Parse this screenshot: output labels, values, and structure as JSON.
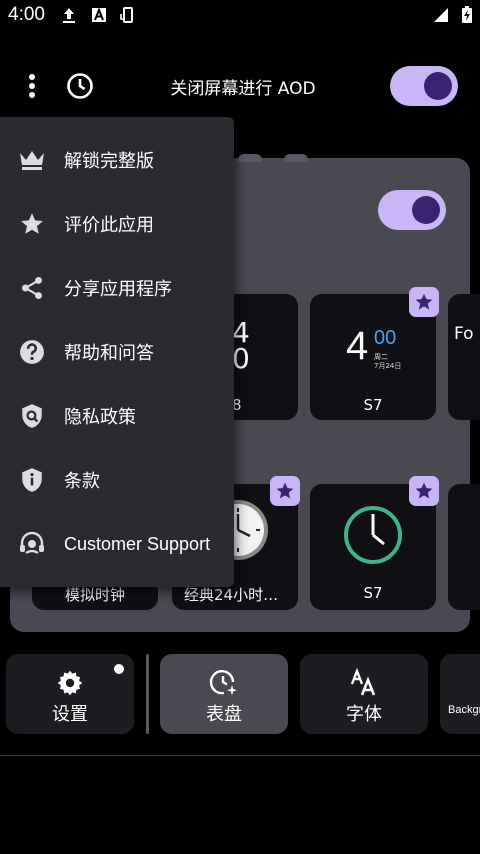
{
  "status_bar": {
    "time": "4:00"
  },
  "top_bar": {
    "title": "关闭屏幕进行 AOD"
  },
  "menu": {
    "items": [
      {
        "label": "解锁完整版",
        "icon": "crown-icon"
      },
      {
        "label": "评价此应用",
        "icon": "star-icon"
      },
      {
        "label": "分享应用程序",
        "icon": "share-icon"
      },
      {
        "label": "帮助和问答",
        "icon": "help-icon"
      },
      {
        "label": "隐私政策",
        "icon": "privacy-shield-icon"
      },
      {
        "label": "条款",
        "icon": "terms-info-icon"
      },
      {
        "label": "Customer Support",
        "icon": "headset-icon"
      }
    ]
  },
  "card": {
    "row1": [
      {
        "partial_time_top": "4",
        "partial_time_bottom": "0",
        "partial_label": "8"
      },
      {
        "label": "S7",
        "time_hour": "4",
        "time_min": "00",
        "date_line1": "周二",
        "date_line2": "7月24日"
      },
      {
        "partial_text": "Fo"
      }
    ],
    "row2": [
      {
        "label": "模拟时钟"
      },
      {
        "label": "经典24小时…"
      },
      {
        "label": "S7"
      }
    ]
  },
  "bottom_nav": {
    "settings": "设置",
    "dial": "表盘",
    "font": "字体",
    "background": "Backgr"
  },
  "colors": {
    "accent": "#c8b6f7",
    "knob": "#3a2472",
    "clock_green": "#3fb489",
    "time_blue": "#4aa3f0"
  }
}
